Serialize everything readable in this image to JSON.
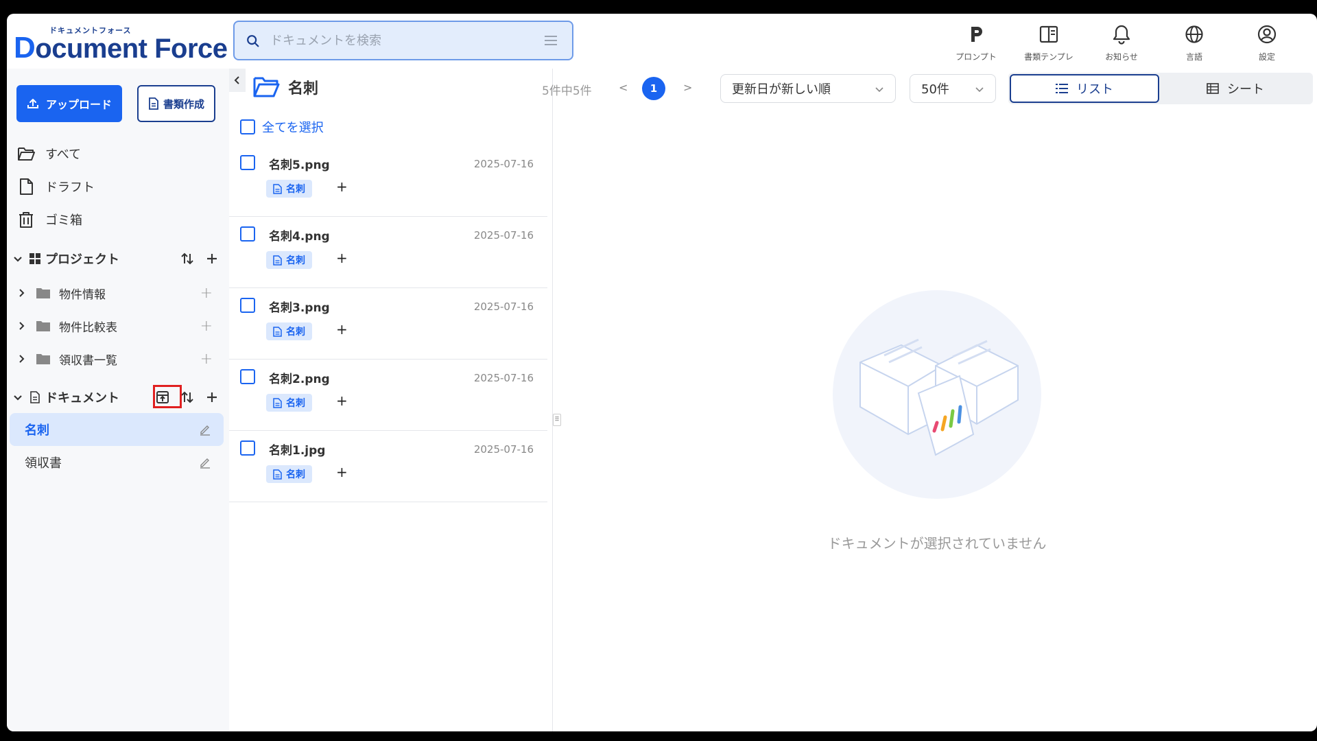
{
  "logo": {
    "kana": "ドキュメントフォース",
    "name_first": "D",
    "name_rest": "ocument Force"
  },
  "search": {
    "placeholder": "ドキュメントを検索",
    "value": ""
  },
  "topnav": [
    {
      "label": "プロンプト",
      "icon": "prompt-icon"
    },
    {
      "label": "書類テンプレ",
      "icon": "template-icon"
    },
    {
      "label": "お知らせ",
      "icon": "bell-icon"
    },
    {
      "label": "言語",
      "icon": "globe-icon"
    },
    {
      "label": "設定",
      "icon": "user-settings-icon"
    }
  ],
  "sidebar": {
    "upload_label": "アップロード",
    "create_label": "書類作成",
    "links": [
      {
        "label": "すべて",
        "icon": "folder-open-icon"
      },
      {
        "label": "ドラフト",
        "icon": "file-icon"
      },
      {
        "label": "ゴミ箱",
        "icon": "trash-icon"
      }
    ],
    "projects": {
      "title": "プロジェクト",
      "items": [
        {
          "label": "物件情報"
        },
        {
          "label": "物件比較表"
        },
        {
          "label": "領収書一覧"
        }
      ]
    },
    "documents": {
      "title": "ドキュメント",
      "items": [
        {
          "label": "名刺",
          "active": true
        },
        {
          "label": "領収書",
          "active": false
        }
      ]
    }
  },
  "list": {
    "folder_title": "名刺",
    "select_all": "全てを選択",
    "rows": [
      {
        "name": "名刺5.png",
        "date": "2025-07-16",
        "tag": "名刺"
      },
      {
        "name": "名刺4.png",
        "date": "2025-07-16",
        "tag": "名刺"
      },
      {
        "name": "名刺3.png",
        "date": "2025-07-16",
        "tag": "名刺"
      },
      {
        "name": "名刺2.png",
        "date": "2025-07-16",
        "tag": "名刺"
      },
      {
        "name": "名刺1.jpg",
        "date": "2025-07-16",
        "tag": "名刺"
      }
    ]
  },
  "toolbar": {
    "count": "5件中5件",
    "prev": "<",
    "page": "1",
    "next": ">",
    "sort": "更新日が新しい順",
    "per_page": "50件",
    "view_list": "リスト",
    "view_sheet": "シート"
  },
  "empty_state": {
    "message": "ドキュメントが選択されていません"
  },
  "colors": {
    "primary": "#1a64f0",
    "navy": "#1a3e8f",
    "highlight": "#e02020"
  }
}
